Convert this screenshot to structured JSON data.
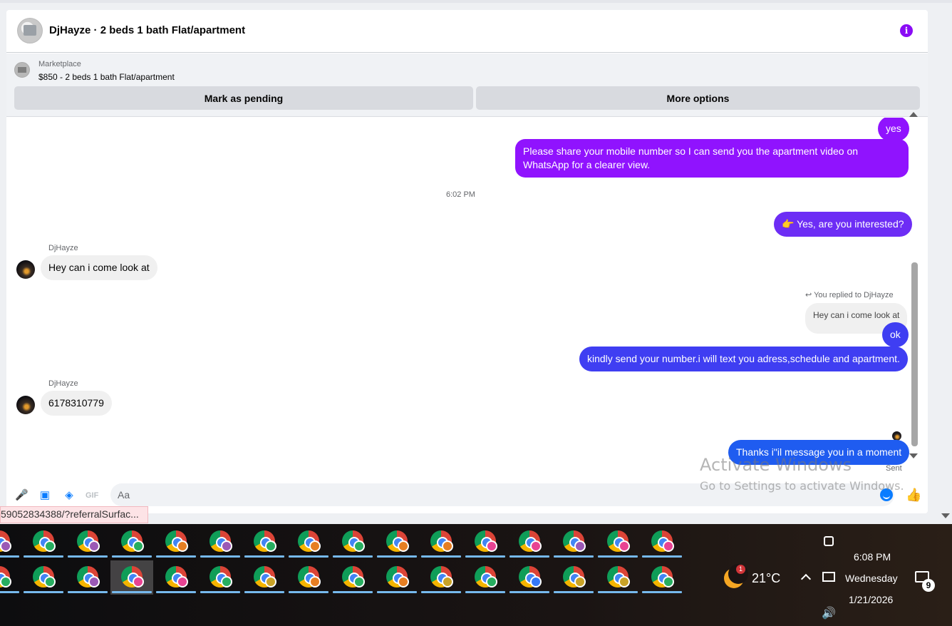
{
  "header": {
    "title": "DjHayze · 2 beds 1 bath Flat/apartment"
  },
  "marketplace": {
    "label": "Marketplace",
    "listing": "$850 - 2 beds 1 bath Flat/apartment",
    "mark_pending_label": "Mark as pending",
    "more_options_label": "More options"
  },
  "messages": {
    "yes": "yes",
    "share_number": "Please share your mobile number so I can send you the apartment video on",
    "share_number_2": "WhatsApp for a clearer view.",
    "timestamp": "6:02 PM",
    "interested": "👉 Yes, are you interested?",
    "sender_1": "DjHayze",
    "incoming_1": "Hey can i come look at",
    "reply_note": "You replied to DjHayze",
    "quoted": "Hey can i come look at",
    "ok": "ok",
    "kindly": "kindly send your number.i will text you adress,schedule and apartment.",
    "sender_2": "DjHayze",
    "incoming_2": "6178310779",
    "thanks": "Thanks i\"il message you in a moment",
    "status": "Sent"
  },
  "composer": {
    "placeholder": "Aa"
  },
  "watermark": {
    "title": "Activate Windows",
    "subtitle": "Go to Settings to activate Windows."
  },
  "status_url": "59052834388/?referralSurfac...",
  "taskbar": {
    "row1_badges": [
      "#9b59b6",
      "#27ae60",
      "#9b59b6",
      "#27ae60",
      "#e67e22",
      "#9b59b6",
      "#27ae60",
      "#e67e22",
      "#27ae60",
      "#e67e22",
      "#e67e22",
      "#e84393",
      "#e84393",
      "#9b59b6",
      "#e84393",
      "#e84393"
    ],
    "row2_badges": [
      "#27ae60",
      "#27ae60",
      "#9b59b6",
      "#e84393",
      "#e84393",
      "#27ae60",
      "#c9a227",
      "#e67e22",
      "#27ae60",
      "#e67e22",
      "#c9a227",
      "#27ae60",
      "#3478f6",
      "#c9a227",
      "#c9a227",
      "#27ae60"
    ],
    "active_row2_index": 3
  },
  "tray": {
    "weather_badge": "1",
    "temperature": "21°C",
    "time": "6:08 PM",
    "day": "Wednesday",
    "date": "1/21/2026",
    "notifications": "9"
  },
  "colors": {
    "accent_purple": "#9013fe",
    "accent_blue": "#1f5cf0",
    "messenger_blue": "#0a7cff"
  }
}
